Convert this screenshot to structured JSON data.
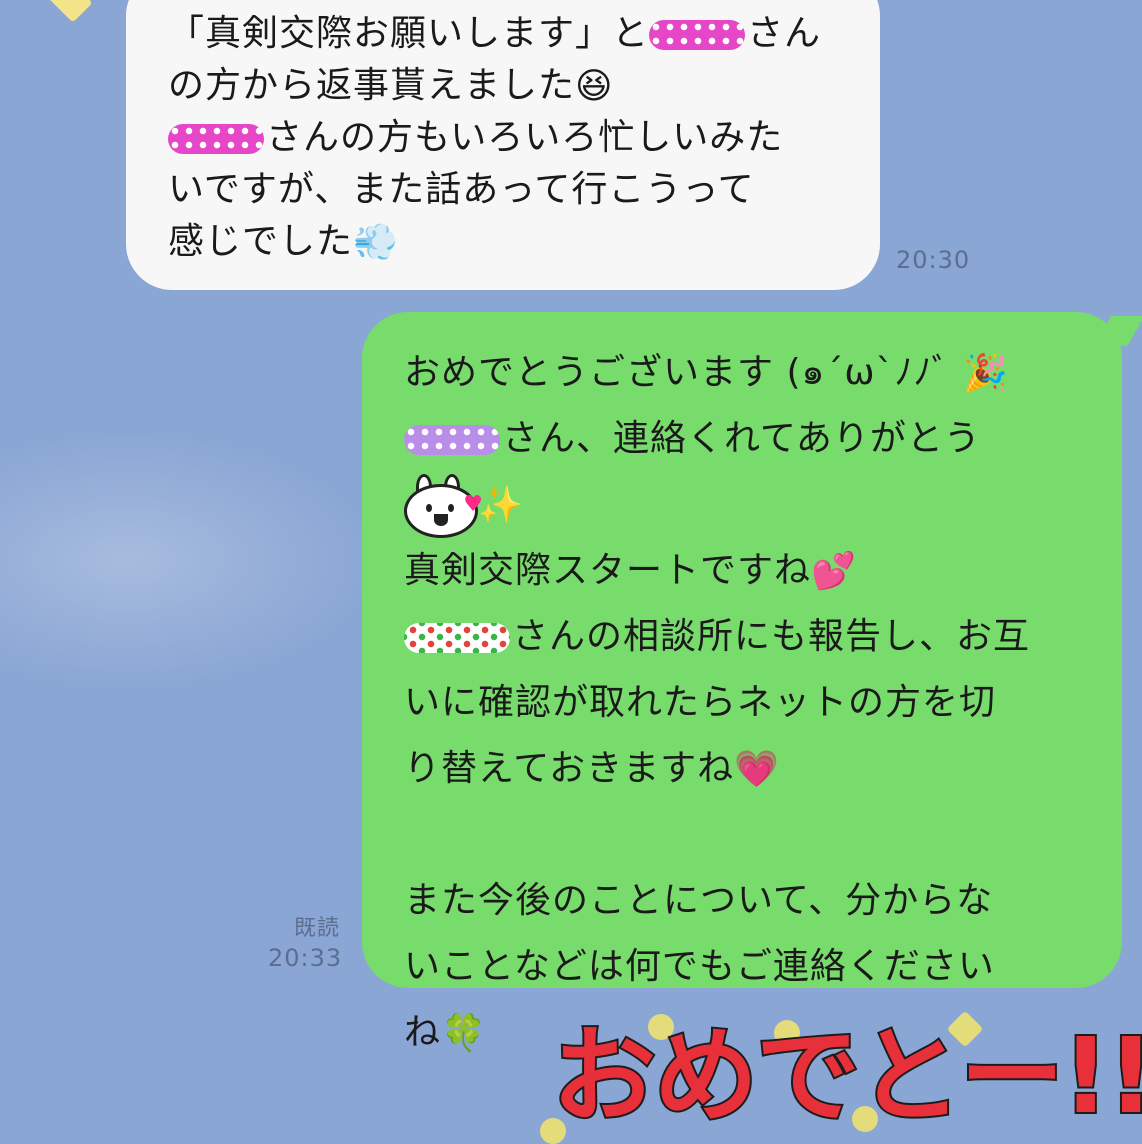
{
  "incoming": {
    "lines": [
      {
        "pre": "「真剣交際お願いします」と",
        "mask": "pink",
        "post": "さん"
      },
      {
        "pre": "の方から返事貰えました",
        "emoji": "😆"
      },
      {
        "mask": "pink",
        "pre": "さんの方もいろいろ忙しいみた"
      },
      {
        "pre": "いですが、また話あって行こうって"
      },
      {
        "pre": "感じでした",
        "emoji": "💨"
      }
    ],
    "time": "20:30"
  },
  "outgoing": {
    "lines": [
      {
        "pre": "おめでとうございます (๑´ω`ﾉﾉﾞ",
        "emoji": "🎉"
      },
      {
        "mask": "purple",
        "pre": "さん、連絡くれてありがとう"
      },
      {
        "sticker": "rabbit-heart",
        "emoji": "✨"
      },
      {
        "pre": "真剣交際スタートですね",
        "emoji": "💕"
      },
      {
        "mask": "dots",
        "pre": "さんの相談所にも報告し、お互"
      },
      {
        "pre": "いに確認が取れたらネットの方を切"
      },
      {
        "pre": "り替えておきますね",
        "emoji": "💗"
      },
      {
        "pre": ""
      },
      {
        "pre": "また今後のことについて、分からな"
      },
      {
        "pre": "いことなどは何でもご連絡ください"
      },
      {
        "pre": "ね",
        "emoji": "🍀"
      }
    ],
    "read_label": "既読",
    "time": "20:33"
  },
  "sticker": {
    "text": "おめでとー!!"
  }
}
